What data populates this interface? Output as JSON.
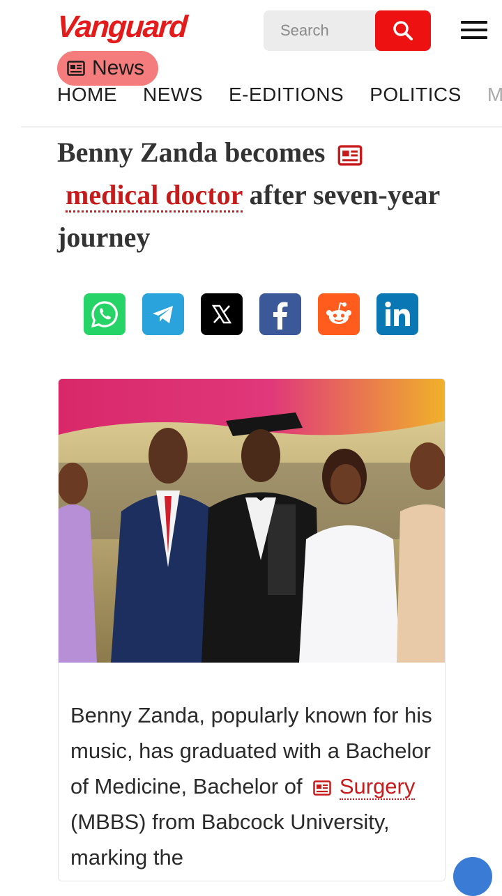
{
  "header": {
    "logo": "Vanguard",
    "search_placeholder": "Search",
    "section_badge": "News"
  },
  "nav": [
    "HOME",
    "NEWS",
    "E-EDITIONS",
    "POLITICS",
    "ME"
  ],
  "article": {
    "headline_part1": "Benny Zanda becomes",
    "headline_link": "medical doctor",
    "headline_part2": "after seven-year journey",
    "body_part1": "Benny Zanda, popularly known for his music, has graduated with a Bachelor of Medicine, Bachelor of",
    "body_link": "Surgery",
    "body_part2": "(MBBS) from Babcock University, marking the"
  },
  "share": [
    "whatsapp-icon",
    "telegram-icon",
    "x-icon",
    "facebook-icon",
    "reddit-icon",
    "linkedin-icon"
  ],
  "colors": {
    "brand_red": "#e31b1b",
    "badge_pink": "#f47c7c",
    "whatsapp": "#25d366",
    "telegram": "#2aa3dc",
    "x": "#000000",
    "facebook": "#3b5998",
    "reddit": "#ff5c1e",
    "linkedin": "#0a77b5"
  }
}
